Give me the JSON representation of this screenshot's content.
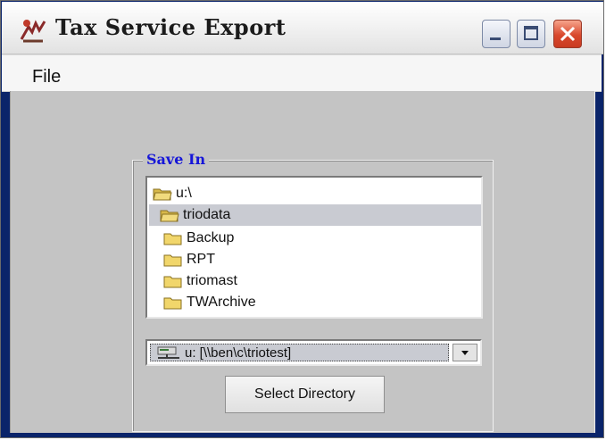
{
  "window": {
    "title": "Tax Service Export"
  },
  "menu": {
    "file": "File"
  },
  "group": {
    "label": "Save In"
  },
  "directory_list": [
    {
      "label": "u:\\",
      "icon": "folder-open-icon",
      "indent": 0,
      "selected": false
    },
    {
      "label": "triodata",
      "icon": "folder-open-icon",
      "indent": 1,
      "selected": true
    },
    {
      "label": "Backup",
      "icon": "folder-icon",
      "indent": 2,
      "selected": false
    },
    {
      "label": "RPT",
      "icon": "folder-icon",
      "indent": 2,
      "selected": false
    },
    {
      "label": "triomast",
      "icon": "folder-icon",
      "indent": 2,
      "selected": false
    },
    {
      "label": "TWArchive",
      "icon": "folder-icon",
      "indent": 2,
      "selected": false
    }
  ],
  "drive_select": {
    "value": "u: [\\\\ben\\c\\triotest]",
    "icon": "network-drive-icon"
  },
  "actions": {
    "select_directory": "Select Directory"
  },
  "colors": {
    "group_label": "#1616d8",
    "client_bg": "#c4c4c4",
    "selection_bg": "#c9cbd2",
    "close_button": "#d8482d"
  }
}
